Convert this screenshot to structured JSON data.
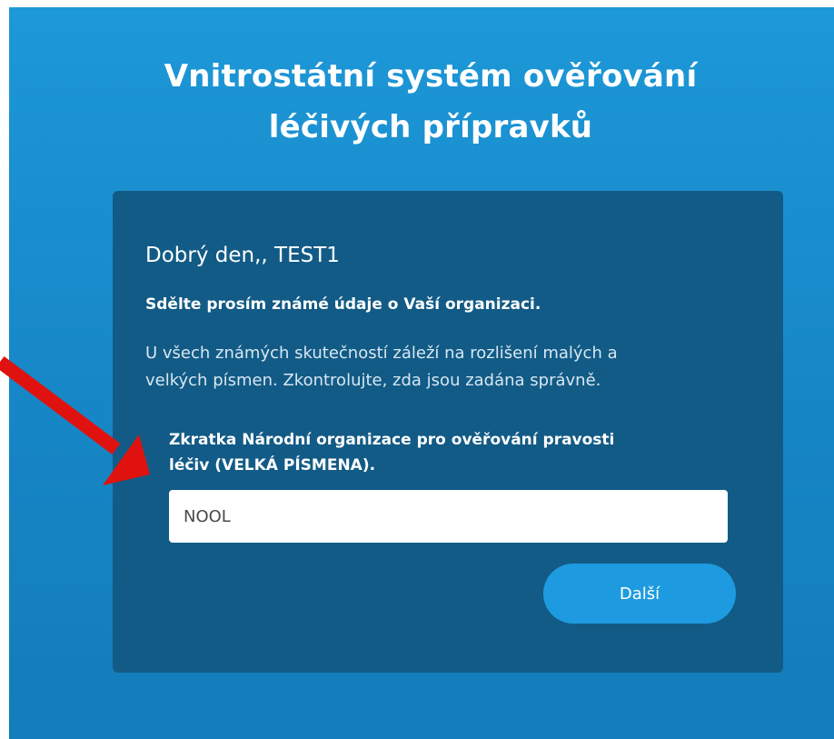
{
  "page": {
    "title": "Vnitrostátní systém ověřování\nléčivých přípravků"
  },
  "card": {
    "greeting": "Dobrý den,, TEST1",
    "subtitle": "Sdělte prosím známé údaje o Vaší organizaci.",
    "info": "U všech známých skutečností záleží na rozlišení malých a\nvelkých písmen. Zkontrolujte, zda jsou zadána správně.",
    "field_label": "Zkratka Národní organizace pro ověřování pravosti\nléčiv (VELKÁ PÍSMENA).",
    "field_value": "NOOL",
    "next_label": "Další"
  },
  "colors": {
    "background": "#1d98d8",
    "card": "#125b86",
    "button": "#1e9be0",
    "annotation_arrow": "#e0120f"
  },
  "annotation": {
    "icon": "red-arrow-icon"
  }
}
